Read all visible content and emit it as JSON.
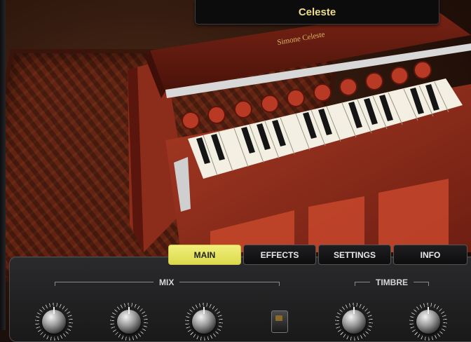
{
  "instrument": {
    "name": "Celeste",
    "maker_plate": "Simone Celeste"
  },
  "tabs": [
    {
      "label": "MAIN",
      "active": true
    },
    {
      "label": "EFFECTS",
      "active": false
    },
    {
      "label": "SETTINGS",
      "active": false
    },
    {
      "label": "INFO",
      "active": false
    }
  ],
  "sections": {
    "mix": "MIX",
    "timbre": "TIMBRE"
  },
  "colors": {
    "accent_tab": "#e8e65c",
    "title_text": "#f1de8a",
    "panel_bg": "#1d1d1e"
  }
}
